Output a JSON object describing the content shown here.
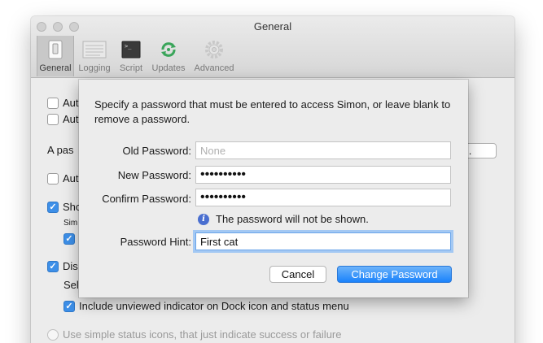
{
  "window": {
    "title": "General",
    "toolbar": [
      {
        "label": "General",
        "icon": "switch-icon",
        "selected": true
      },
      {
        "label": "Logging",
        "icon": "log-icon",
        "selected": false
      },
      {
        "label": "Script",
        "icon": "terminal-icon",
        "selected": false
      },
      {
        "label": "Updates",
        "icon": "refresh-icon",
        "selected": false
      },
      {
        "label": "Advanced",
        "icon": "gear-icon",
        "selected": false
      }
    ]
  },
  "background": {
    "row1": "Aut",
    "row2": "Aut",
    "row3": "A pas",
    "button_right": "rd...",
    "row4": "Aut",
    "row5": "Sho",
    "row5_sub": "Sim",
    "row7": "Dis",
    "row8": "Sel",
    "row9": "Include unviewed indicator on Dock icon and status menu",
    "row10": "Use simple status icons, that just indicate success or failure"
  },
  "sheet": {
    "prompt": "Specify a password that must be entered to access Simon, or leave blank to remove a password.",
    "old_password": {
      "label": "Old Password:",
      "placeholder": "None",
      "value": ""
    },
    "new_password": {
      "label": "New Password:",
      "value": "••••••••••"
    },
    "confirm_password": {
      "label": "Confirm Password:",
      "value": "••••••••••"
    },
    "note": "The password will not be shown.",
    "hint": {
      "label": "Password Hint:",
      "value": "First cat"
    },
    "cancel_label": "Cancel",
    "confirm_label": "Change Password",
    "accent": "#1a82fb"
  }
}
